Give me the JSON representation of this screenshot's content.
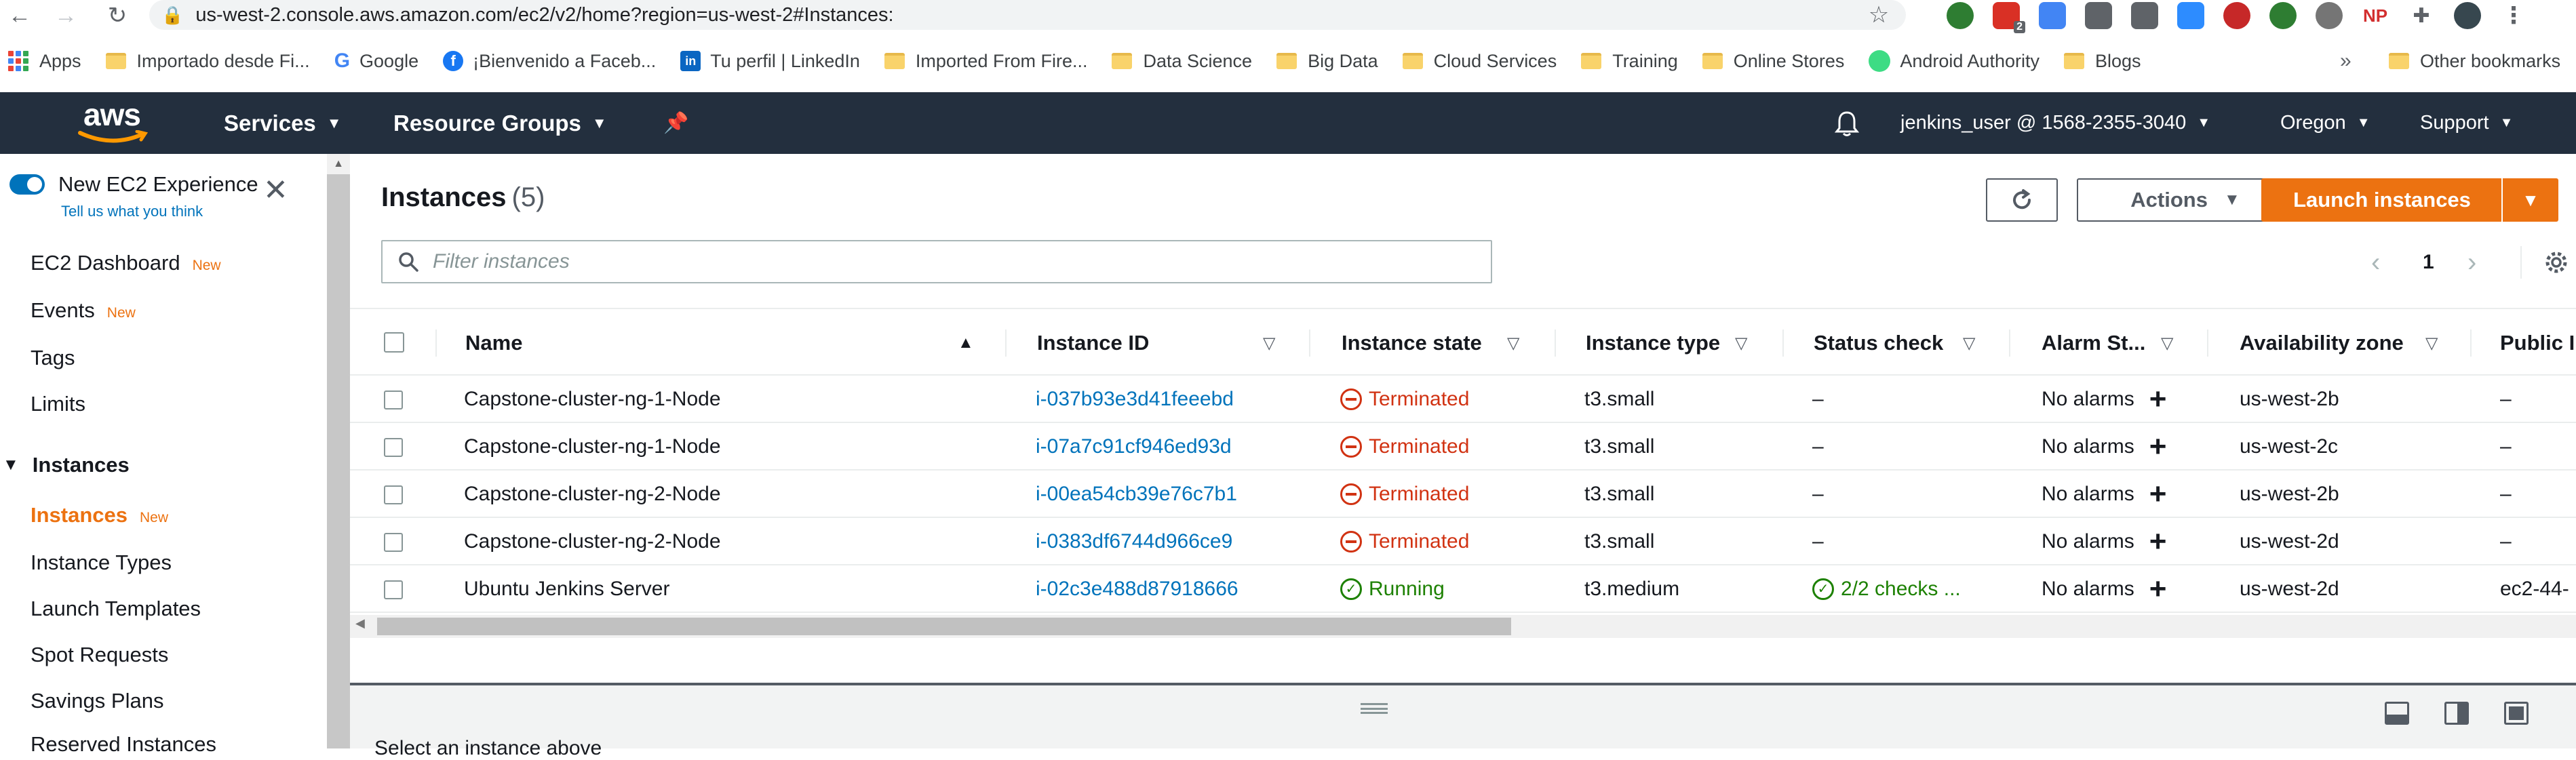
{
  "browser": {
    "url": "us-west-2.console.aws.amazon.com/ec2/v2/home?region=us-west-2#Instances:",
    "bookmarks": [
      {
        "label": "Apps",
        "icon": "apps-grid-icon"
      },
      {
        "label": "Importado desde Fi...",
        "icon": "folder-icon"
      },
      {
        "label": "Google",
        "icon": "google-icon"
      },
      {
        "label": "¡Bienvenido a Faceb...",
        "icon": "facebook-icon"
      },
      {
        "label": "Tu perfil | LinkedIn",
        "icon": "linkedin-icon"
      },
      {
        "label": "Imported From Fire...",
        "icon": "folder-icon"
      },
      {
        "label": "Data Science",
        "icon": "folder-icon"
      },
      {
        "label": "Big Data",
        "icon": "folder-icon"
      },
      {
        "label": "Cloud Services",
        "icon": "folder-icon"
      },
      {
        "label": "Training",
        "icon": "folder-icon"
      },
      {
        "label": "Online Stores",
        "icon": "folder-icon"
      },
      {
        "label": "Android Authority",
        "icon": "android-icon"
      },
      {
        "label": "Blogs",
        "icon": "folder-icon"
      }
    ],
    "more_bookmarks": "»",
    "other_bookmarks": "Other bookmarks",
    "ext_badge": "2",
    "ext_np": "NP"
  },
  "aws_nav": {
    "logo": "aws",
    "services": "Services",
    "resource_groups": "Resource Groups",
    "account": "jenkins_user @ 1568-2355-3040",
    "region": "Oregon",
    "support": "Support"
  },
  "sidebar": {
    "new_experience": "New EC2 Experience",
    "tell_us": "Tell us what you think",
    "dashboard": "EC2 Dashboard",
    "events": "Events",
    "tags": "Tags",
    "limits": "Limits",
    "section_instances": "Instances",
    "instances": "Instances",
    "instance_types": "Instance Types",
    "launch_templates": "Launch Templates",
    "spot_requests": "Spot Requests",
    "savings_plans": "Savings Plans",
    "reserved_instances": "Reserved Instances",
    "new_badge": "New"
  },
  "main": {
    "title": "Instances",
    "count": "(5)",
    "actions": "Actions",
    "launch": "Launch instances",
    "filter_placeholder": "Filter instances",
    "page": "1",
    "select_prompt": "Select an instance above"
  },
  "table": {
    "columns": {
      "name": "Name",
      "instance_id": "Instance ID",
      "instance_state": "Instance state",
      "instance_type": "Instance type",
      "status_check": "Status check",
      "alarm_status": "Alarm St...",
      "availability_zone": "Availability zone",
      "public": "Public I"
    },
    "rows": [
      {
        "name": "Capstone-cluster-ng-1-Node",
        "id": "i-037b93e3d41feeebd",
        "state": "Terminated",
        "type": "t3.small",
        "status": "–",
        "alarm": "No alarms",
        "az": "us-west-2b",
        "public": "–"
      },
      {
        "name": "Capstone-cluster-ng-1-Node",
        "id": "i-07a7c91cf946ed93d",
        "state": "Terminated",
        "type": "t3.small",
        "status": "–",
        "alarm": "No alarms",
        "az": "us-west-2c",
        "public": "–"
      },
      {
        "name": "Capstone-cluster-ng-2-Node",
        "id": "i-00ea54cb39e76c7b1",
        "state": "Terminated",
        "type": "t3.small",
        "status": "–",
        "alarm": "No alarms",
        "az": "us-west-2b",
        "public": "–"
      },
      {
        "name": "Capstone-cluster-ng-2-Node",
        "id": "i-0383df6744d966ce9",
        "state": "Terminated",
        "type": "t3.small",
        "status": "–",
        "alarm": "No alarms",
        "az": "us-west-2d",
        "public": "–"
      },
      {
        "name": "Ubuntu Jenkins Server",
        "id": "i-02c3e488d87918666",
        "state": "Running",
        "type": "t3.medium",
        "status": "2/2 checks ...",
        "alarm": "No alarms",
        "az": "us-west-2d",
        "public": "ec2-44-"
      }
    ]
  }
}
